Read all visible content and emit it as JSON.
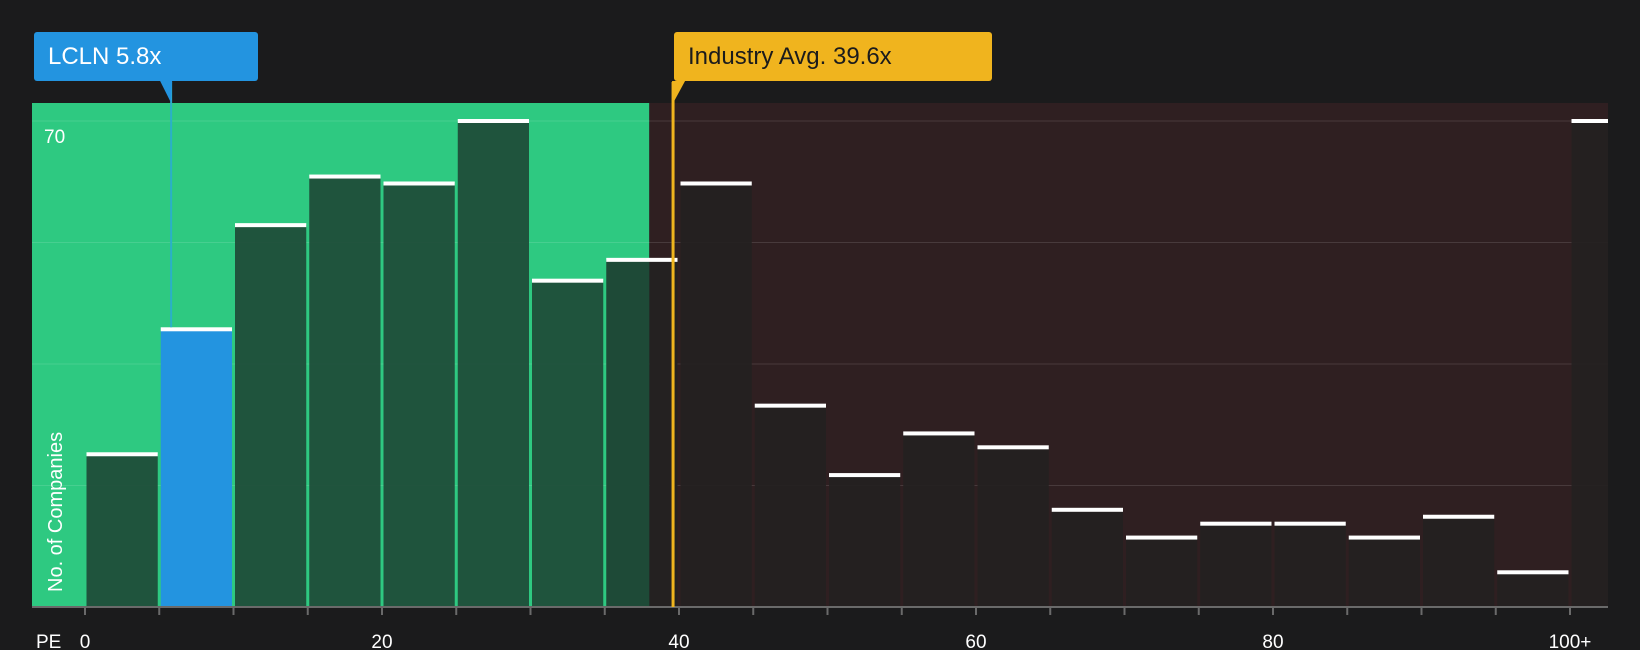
{
  "colors": {
    "background": "#1b1b1c",
    "good_zone": "#2ec981",
    "bad_zone": "#2f1f21",
    "highlight_bar": "#2394e0",
    "bar_in_good_zone": "#1e4a37",
    "bar_in_bad_zone": "#242121",
    "industry_line": "#f0b41e",
    "company_line": "#2ab0c8",
    "bar_cap": "#ffffff"
  },
  "company_callout": {
    "label": "LCLN 5.8x",
    "ticker": "LCLN",
    "value": 5.8
  },
  "industry_callout": {
    "label": "Industry Avg. 39.6x",
    "value": 39.6
  },
  "chart_data": {
    "type": "bar",
    "x_axis_label": "PE",
    "y_axis_label": "No. of Companies",
    "ylim": [
      0,
      72
    ],
    "y_ticks": [
      0,
      17.5,
      35,
      52.5,
      70
    ],
    "y_tick_labels_shown": [
      "70"
    ],
    "x_tick_values": [
      0,
      20,
      40,
      60,
      80,
      100
    ],
    "x_tick_labels": [
      "0",
      "20",
      "40",
      "60",
      "80",
      "100+"
    ],
    "bin_width": 5,
    "bins": [
      0,
      5,
      10,
      15,
      20,
      25,
      30,
      35,
      40,
      45,
      50,
      55,
      60,
      65,
      70,
      75,
      80,
      85,
      90,
      95,
      100
    ],
    "values": [
      22,
      40,
      55,
      62,
      61,
      70,
      47,
      50,
      61,
      29,
      19,
      25,
      23,
      14,
      10,
      12,
      12,
      10,
      13,
      5,
      70
    ],
    "highlighted_bin_index": 1,
    "company_value": 5.8,
    "industry_average": 39.6,
    "good_zone_upper": 38,
    "grid": true
  }
}
